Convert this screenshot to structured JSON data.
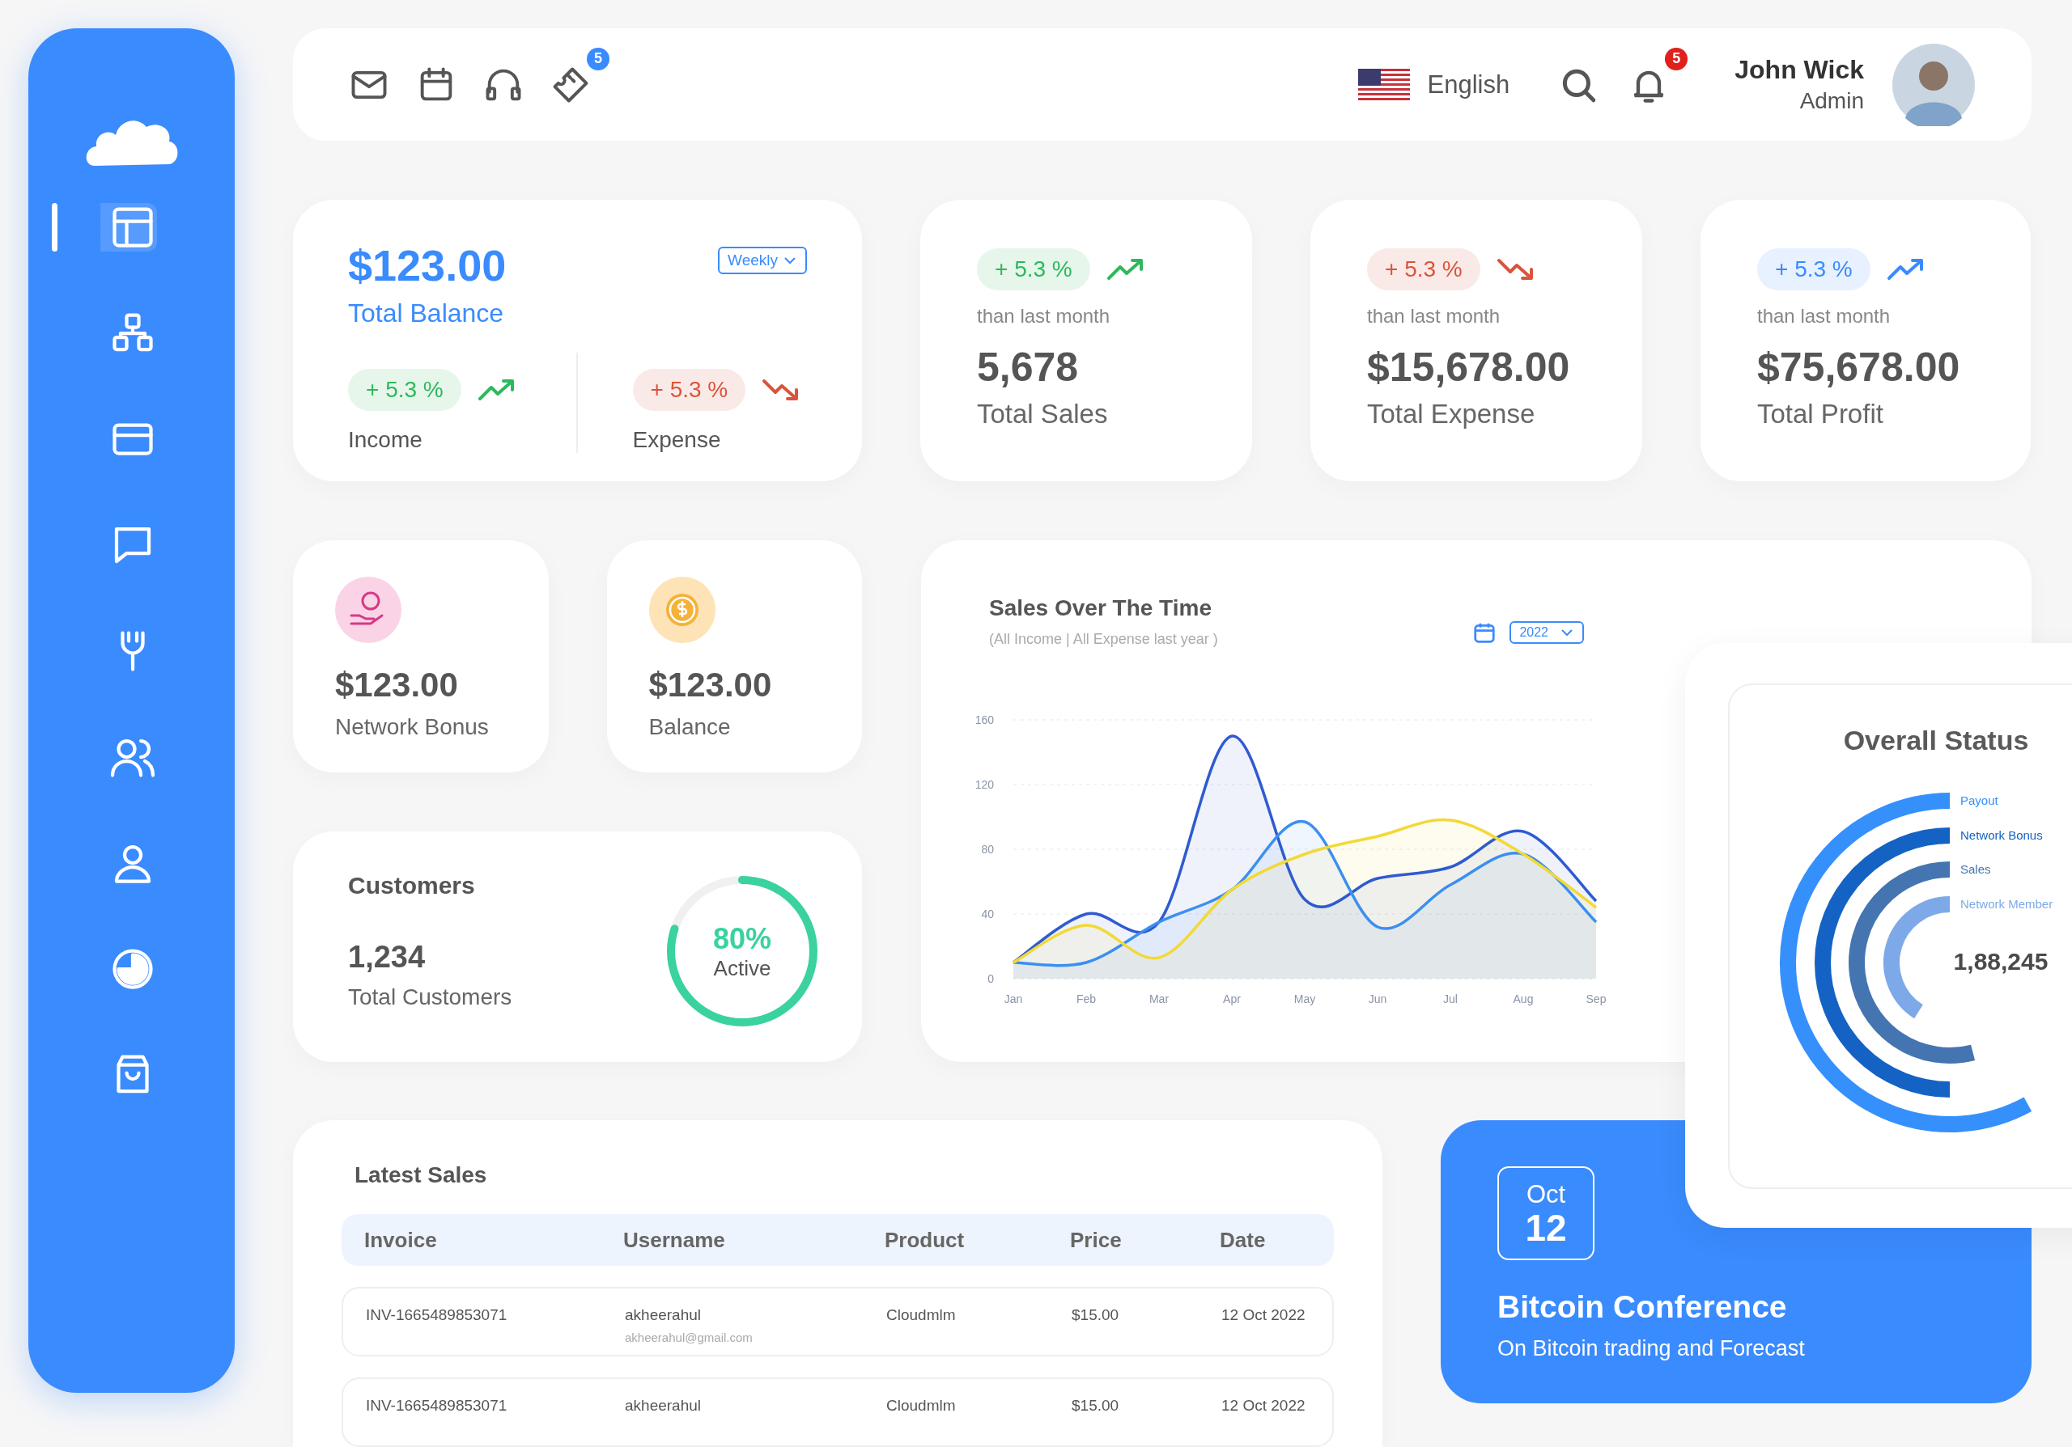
{
  "sidebar": {
    "nav": [
      {
        "kind": "layout",
        "selected": true
      },
      {
        "kind": "grid",
        "selected": false
      },
      {
        "kind": "card",
        "selected": false
      },
      {
        "kind": "chat",
        "selected": false
      },
      {
        "kind": "tools",
        "selected": false
      },
      {
        "kind": "users",
        "selected": false
      },
      {
        "kind": "user",
        "selected": false
      },
      {
        "kind": "pie",
        "selected": false
      },
      {
        "kind": "bag",
        "selected": false
      }
    ]
  },
  "topbar": {
    "icons": [
      {
        "kind": "mail"
      },
      {
        "kind": "calendar"
      },
      {
        "kind": "headset"
      },
      {
        "kind": "ticket",
        "badge": "5"
      }
    ],
    "language": "English",
    "notifications": "5",
    "user": {
      "name": "John Wick",
      "role": "Admin"
    }
  },
  "balance_card": {
    "amount": "$123.00",
    "label": "Total Balance",
    "period": "Weekly",
    "parts": [
      {
        "change": "+ 5.3 %",
        "rising": true,
        "color": "#2eb85c",
        "label": "Income"
      },
      {
        "change": "+ 5.3 %",
        "rising": false,
        "color": "#d9543a",
        "label": "Expense"
      }
    ]
  },
  "stats": [
    {
      "change": "+ 5.3 %",
      "rising": true,
      "color": "#2eb85c",
      "caption": "than last month",
      "value": "5,678",
      "label": "Total Sales"
    },
    {
      "change": "+ 5.3 %",
      "rising": false,
      "color": "#d9543a",
      "caption": "than last month",
      "value": "$15,678.00",
      "label": "Total Expense"
    },
    {
      "change": "+ 5.3 %",
      "rising": true,
      "color": "#3a8bfd",
      "caption": "than last month",
      "value": "$75,678.00",
      "label": "Total Profit"
    }
  ],
  "mini_cards": [
    {
      "kind": "bonus",
      "value": "$123.00",
      "label": "Network Bonus"
    },
    {
      "kind": "coin",
      "value": "$123.00",
      "label": "Balance"
    }
  ],
  "customers": {
    "title": "Customers",
    "count": "1,234",
    "label": "Total Customers",
    "percent": "80%",
    "status": "Active",
    "level": 0.8
  },
  "sales_chart": {
    "title": "Sales Over The Time",
    "subtitle": "(All Income | All Expense last year )",
    "year": "2022",
    "chart_data": {
      "type": "area",
      "grid": true,
      "categories": [
        "Jan",
        "Feb",
        "Mar",
        "Apr",
        "May",
        "Jun",
        "Jul",
        "Aug",
        "Sep"
      ],
      "ylim": [
        0,
        160
      ],
      "yticks": [
        0,
        40,
        80,
        120,
        160
      ],
      "series": [
        {
          "color": "#2f5bd0",
          "values": [
            10,
            40,
            35,
            150,
            49,
            62,
            69,
            91,
            48
          ]
        },
        {
          "color": "#3b8ff0",
          "values": [
            10,
            10,
            35,
            55,
            97,
            32,
            58,
            77,
            35
          ]
        },
        {
          "color": "#f2d935",
          "values": [
            10,
            33,
            13,
            55,
            77,
            88,
            98,
            77,
            44
          ]
        }
      ]
    }
  },
  "overall_status": {
    "title": "Overall Status",
    "total": "1,88,245",
    "items": [
      {
        "label": "Payout",
        "color": "#3590fc"
      },
      {
        "label": "Network Bonus",
        "color": "#1462c4"
      },
      {
        "label": "Sales",
        "color": "#4575b0"
      },
      {
        "label": "Network Member",
        "color": "#7ea9e8"
      }
    ]
  },
  "latest_sales": {
    "title": "Latest Sales",
    "columns": [
      "Invoice",
      "Username",
      "Product",
      "Price",
      "Date"
    ],
    "rows": [
      {
        "invoice": "INV-1665489853071",
        "username": "akheerahul",
        "email": "akheerahul@gmail.com",
        "product": "Cloudmlm",
        "price": "$15.00",
        "date": "12 Oct 2022"
      },
      {
        "invoice": "INV-1665489853071",
        "username": "akheerahul",
        "product": "Cloudmlm",
        "price": "$15.00",
        "date": "12 Oct 2022"
      }
    ]
  },
  "event": {
    "month": "Oct",
    "day": "12",
    "title": "Bitcoin Conference",
    "subtitle": "On Bitcoin trading and Forecast"
  }
}
